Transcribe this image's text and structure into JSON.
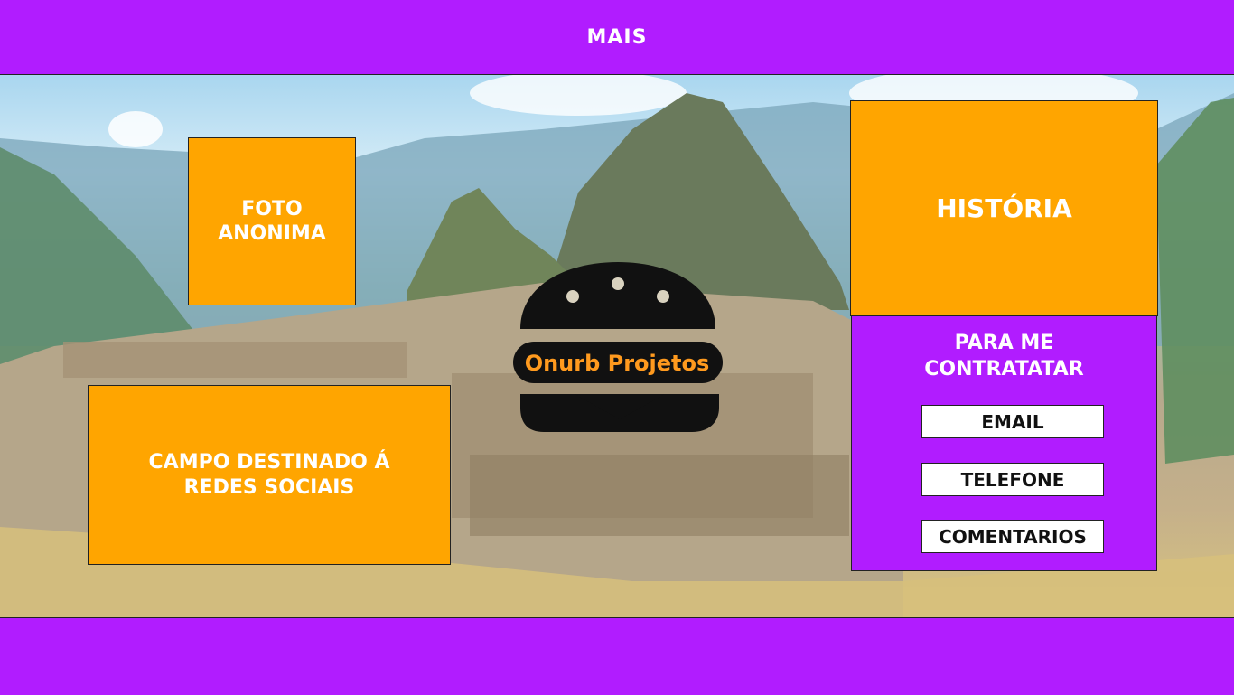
{
  "nav": {
    "more_label": "MAIS"
  },
  "photo_panel": {
    "label": "FOTO\nANONIMA"
  },
  "social_panel": {
    "label": "CAMPO DESTINADO Á\nREDES SOCIAIS"
  },
  "history_panel": {
    "label": "HISTÓRIA"
  },
  "contact": {
    "title": "PARA ME\nCONTRATATAR",
    "buttons": [
      "EMAIL",
      "TELEFONE",
      "COMENTARIOS"
    ]
  },
  "logo": {
    "text": "Onurb Projetos",
    "icon": "burger-icon"
  },
  "colors": {
    "purple": "#b11cff",
    "orange": "#ffa500",
    "logo_text": "#ff9a1e",
    "burger": "#111111"
  }
}
